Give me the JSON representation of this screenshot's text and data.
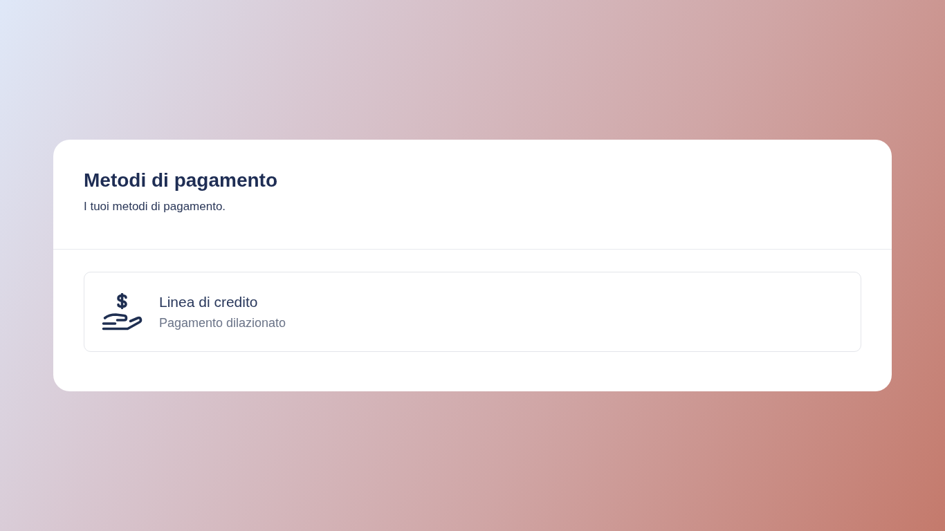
{
  "card": {
    "title": "Metodi di pagamento",
    "subtitle": "I tuoi metodi di pagamento."
  },
  "payment_methods": [
    {
      "kind": "credit_line",
      "name": "Linea di credito",
      "description": "Pagamento dilazionato"
    }
  ]
}
